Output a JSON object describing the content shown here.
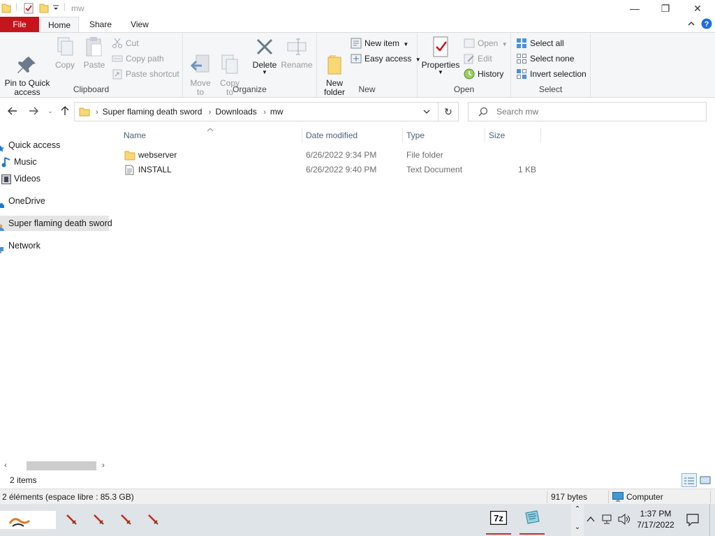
{
  "window": {
    "title": "mw",
    "controls": {
      "minimize": "—",
      "maximize": "❐",
      "close": "✕"
    }
  },
  "ribbon_tabs": [
    {
      "label": "File"
    },
    {
      "label": "Home"
    },
    {
      "label": "Share"
    },
    {
      "label": "View"
    }
  ],
  "ribbon": {
    "clipboard": {
      "label": "Clipboard",
      "pin": "Pin to Quick\naccess",
      "copy": "Copy",
      "paste": "Paste",
      "cut": "Cut",
      "copy_path": "Copy path",
      "paste_shortcut": "Paste shortcut"
    },
    "organize": {
      "label": "Organize",
      "move_to": "Move\nto",
      "copy_to": "Copy\nto",
      "delete": "Delete",
      "rename": "Rename"
    },
    "new": {
      "label": "New",
      "new_folder": "New\nfolder",
      "new_item": "New item",
      "easy_access": "Easy access"
    },
    "open": {
      "label": "Open",
      "properties": "Properties",
      "open": "Open",
      "edit": "Edit",
      "history": "History"
    },
    "select": {
      "label": "Select",
      "select_all": "Select all",
      "select_none": "Select none",
      "invert": "Invert selection"
    }
  },
  "address": {
    "crumbs": [
      "Super flaming death sword",
      "Downloads",
      "mw"
    ],
    "search_placeholder": "Search mw"
  },
  "nav_pane": {
    "items": [
      {
        "label": "Quick access",
        "icon": "star-icon"
      },
      {
        "label": "Music",
        "icon": "music-icon"
      },
      {
        "label": "Videos",
        "icon": "videos-icon"
      },
      {
        "label": "OneDrive",
        "icon": "cloud-icon"
      },
      {
        "label": "Super flaming death sword",
        "icon": "user-icon",
        "selected": true
      },
      {
        "label": "Network",
        "icon": "network-icon"
      }
    ]
  },
  "columns": {
    "name": "Name",
    "date": "Date modified",
    "type": "Type",
    "size": "Size"
  },
  "files": [
    {
      "name": "webserver",
      "date": "6/26/2022 9:34 PM",
      "type": "File folder",
      "size": "",
      "icon": "folder-icon"
    },
    {
      "name": "INSTALL",
      "date": "6/26/2022 9:40 PM",
      "type": "Text Document",
      "size": "1 KB",
      "icon": "text-file-icon"
    }
  ],
  "status": {
    "item_count": "2 items"
  },
  "info_bar": {
    "left": "2 éléments (espace libre : 85.3 GB)",
    "size": "917 bytes",
    "location": "Computer"
  },
  "taskbar": {
    "time": "1:37 PM",
    "date": "7/17/2022"
  },
  "colors": {
    "file_tab": "#c4151c",
    "folder": "#f8d775",
    "header_text": "#4c607a",
    "taskbar": "#dfe4e8"
  }
}
